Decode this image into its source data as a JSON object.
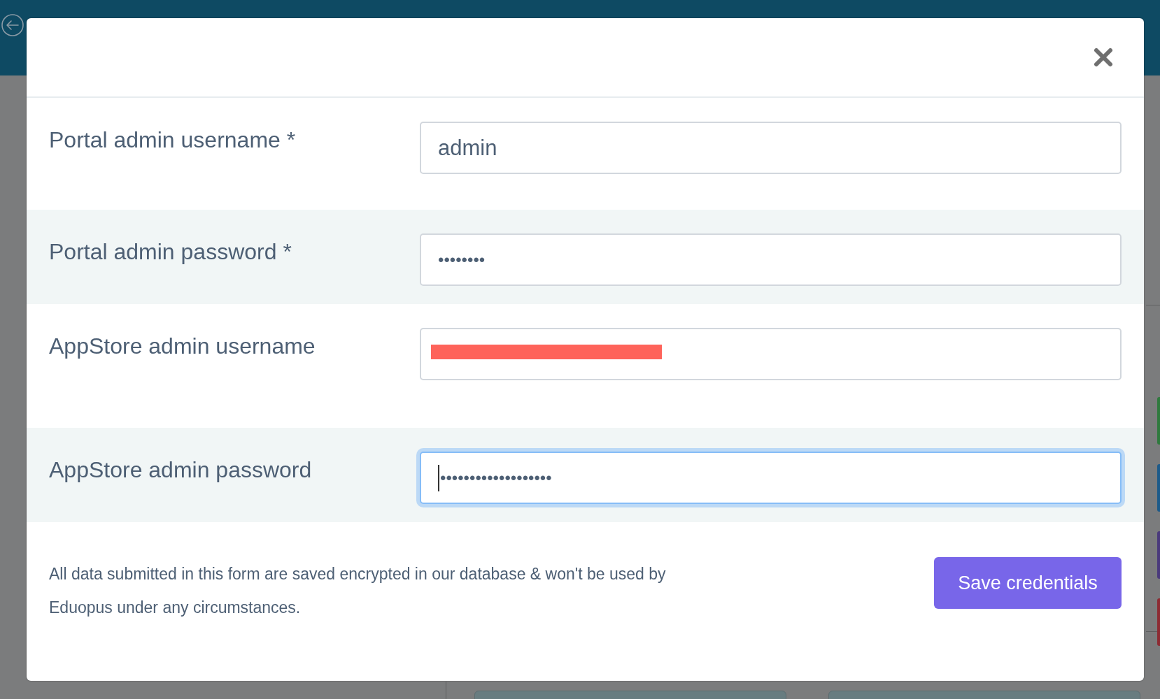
{
  "dialog": {
    "fields": [
      {
        "label": "Portal admin username *",
        "value": "admin",
        "kind": "text",
        "focused": false,
        "redacted": false
      },
      {
        "label": "Portal admin password *",
        "value": "••••••••",
        "kind": "password",
        "focused": false,
        "redacted": false
      },
      {
        "label": "AppStore admin username",
        "kind": "text",
        "focused": false,
        "redacted": true
      },
      {
        "label": "AppStore admin password",
        "value": "•••••••••••••••••••",
        "kind": "password",
        "focused": true,
        "redacted": false
      }
    ],
    "note": "All data submitted in this form are saved encrypted in our database & won't be used by Eduopus under any circumstances.",
    "button": "Save credentials"
  }
}
